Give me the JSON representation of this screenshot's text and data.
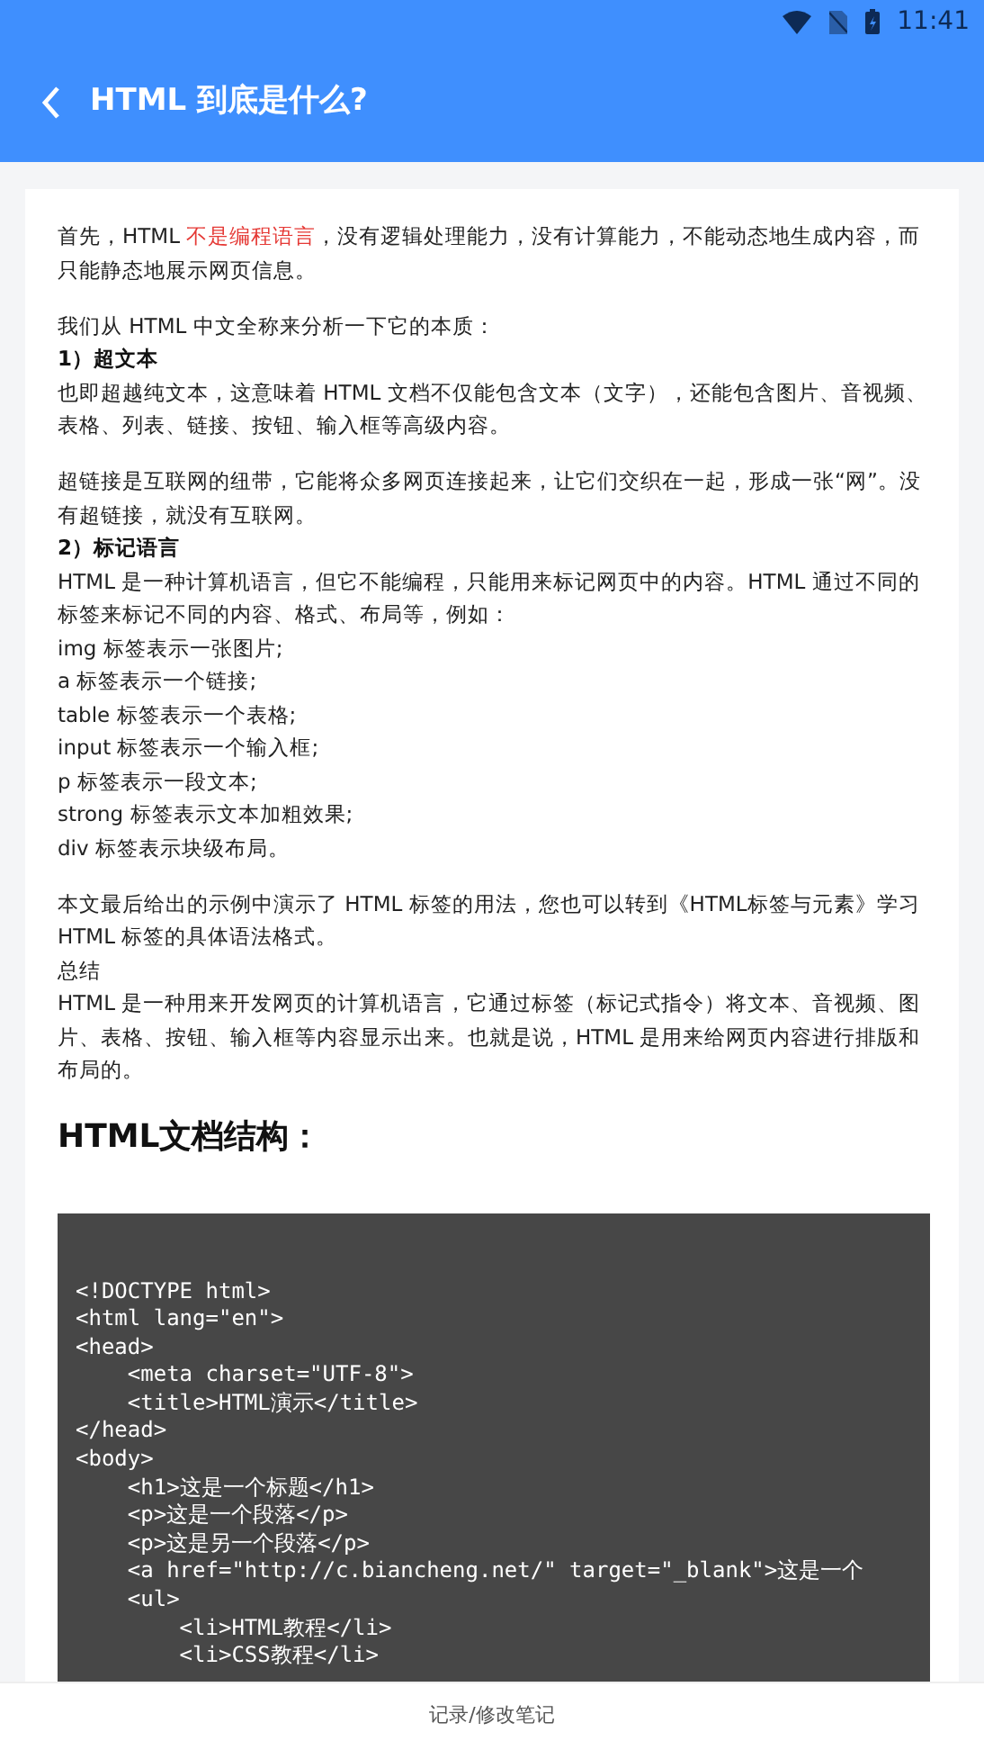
{
  "status_bar": {
    "time": "11:41"
  },
  "app_bar": {
    "title": "HTML 到底是什么?"
  },
  "article": [
    {
      "kind": "paragraph",
      "segments": [
        {
          "text": "首先，HTML ",
          "highlight": false
        },
        {
          "text": "不是编程语言",
          "highlight": true
        },
        {
          "text": "，没有逻辑处理能力，没有计算能力，不能动态地生成内容，而只能静态地展示网页信息。",
          "highlight": false
        }
      ]
    },
    {
      "kind": "gap"
    },
    {
      "kind": "paragraph",
      "segments": [
        {
          "text": "我们从 HTML 中文全称来分析一下它的本质：",
          "highlight": false
        }
      ]
    },
    {
      "kind": "subheading",
      "text": "1）超文本"
    },
    {
      "kind": "paragraph",
      "segments": [
        {
          "text": "也即超越纯文本，这意味着 HTML 文档不仅能包含文本（文字），还能包含图片、音视频、表格、列表、链接、按钮、输入框等高级内容。",
          "highlight": false
        }
      ]
    },
    {
      "kind": "gap"
    },
    {
      "kind": "paragraph",
      "segments": [
        {
          "text": "超链接是互联网的纽带，它能将众多网页连接起来，让它们交织在一起，形成一张“网”。没有超链接，就没有互联网。",
          "highlight": false
        }
      ]
    },
    {
      "kind": "subheading",
      "text": "2）标记语言"
    },
    {
      "kind": "paragraph",
      "segments": [
        {
          "text": "HTML 是一种计算机语言，但它不能编程，只能用来标记网页中的内容。HTML 通过不同的标签来标记不同的内容、格式、布局等，例如：",
          "highlight": false
        }
      ]
    },
    {
      "kind": "paragraph",
      "segments": [
        {
          "text": "img 标签表示一张图片;",
          "highlight": false
        }
      ]
    },
    {
      "kind": "paragraph",
      "segments": [
        {
          "text": "a 标签表示一个链接;",
          "highlight": false
        }
      ]
    },
    {
      "kind": "paragraph",
      "segments": [
        {
          "text": "table 标签表示一个表格;",
          "highlight": false
        }
      ]
    },
    {
      "kind": "paragraph",
      "segments": [
        {
          "text": "input 标签表示一个输入框;",
          "highlight": false
        }
      ]
    },
    {
      "kind": "paragraph",
      "segments": [
        {
          "text": "p 标签表示一段文本;",
          "highlight": false
        }
      ]
    },
    {
      "kind": "paragraph",
      "segments": [
        {
          "text": "strong 标签表示文本加粗效果;",
          "highlight": false
        }
      ]
    },
    {
      "kind": "paragraph",
      "segments": [
        {
          "text": "div 标签表示块级布局。",
          "highlight": false
        }
      ]
    },
    {
      "kind": "gap"
    },
    {
      "kind": "paragraph",
      "segments": [
        {
          "text": "本文最后给出的示例中演示了 HTML 标签的用法，您也可以转到《HTML标签与元素》学习 HTML 标签的具体语法格式。",
          "highlight": false
        }
      ]
    },
    {
      "kind": "paragraph",
      "segments": [
        {
          "text": "总结",
          "highlight": false
        }
      ]
    },
    {
      "kind": "paragraph",
      "segments": [
        {
          "text": "HTML 是一种用来开发网页的计算机语言，它通过标签（标记式指令）将文本、音视频、图片、表格、按钮、输入框等内容显示出来。也就是说，HTML 是用来给网页内容进行排版和布局的。",
          "highlight": false
        }
      ]
    },
    {
      "kind": "heading",
      "text": "HTML文档结构："
    },
    {
      "kind": "code",
      "lines": [
        "<!DOCTYPE html>",
        "<html lang=\"en\">",
        "<head>",
        "    <meta charset=\"UTF-8\">",
        "    <title>HTML演示</title>",
        "</head>",
        "<body>",
        "    <h1>这是一个标题</h1>",
        "    <p>这是一个段落</p>",
        "    <p>这是另一个段落</p>",
        "    <a href=\"http://c.biancheng.net/\" target=\"_blank\">这是一个",
        "    <ul>",
        "        <li>HTML教程</li>",
        "        <li>CSS教程</li>"
      ]
    }
  ],
  "bottom_bar": {
    "label": "记录/修改笔记"
  }
}
